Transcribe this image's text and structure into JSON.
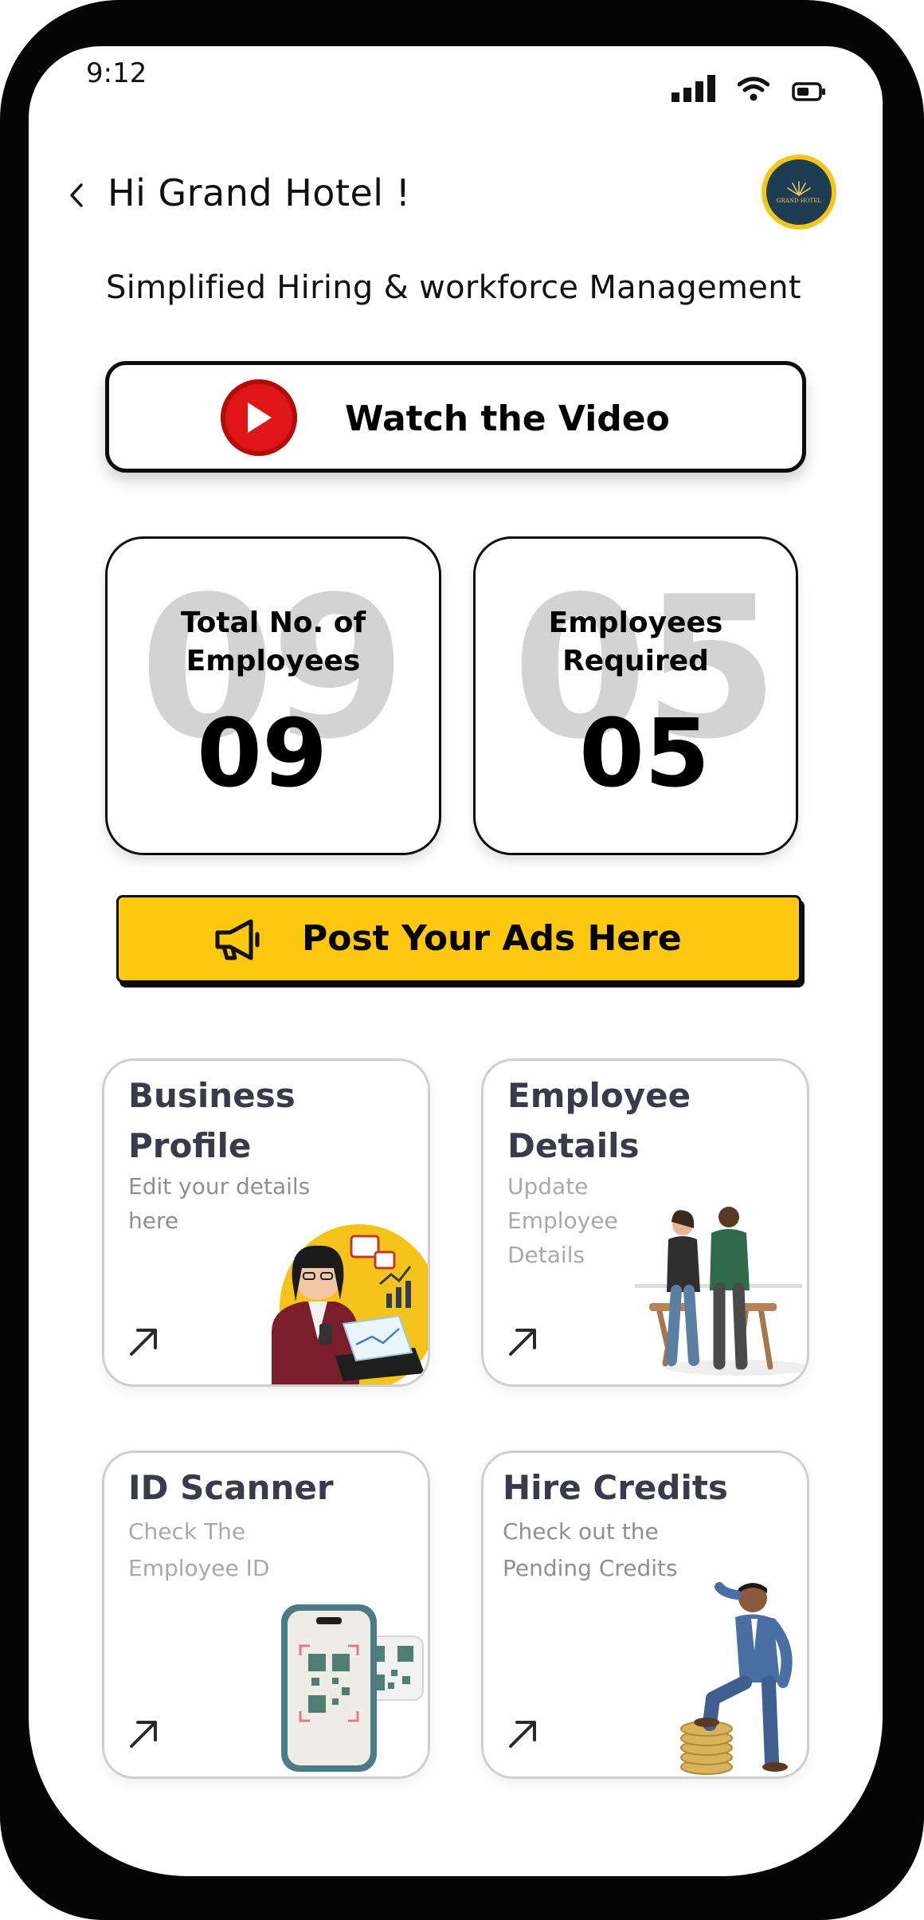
{
  "status_bar": {
    "time": "9:12"
  },
  "header": {
    "greeting": "Hi Grand Hotel !",
    "logo_label": "GRAND HOTEL"
  },
  "tagline": "Simplified Hiring & workforce Management",
  "video_button": {
    "label": "Watch the Video"
  },
  "stats": [
    {
      "title_line1": "Total No. of",
      "title_line2": "Employees",
      "value": "09"
    },
    {
      "title_line1": "Employees",
      "title_line2": "Required",
      "value": "05"
    }
  ],
  "ads_button": {
    "label": "Post Your Ads Here"
  },
  "features": [
    {
      "title": "Business Profile",
      "desc": "Edit your details here"
    },
    {
      "title": "Employee Details",
      "desc": "Update Employee Details"
    },
    {
      "title": "ID Scanner",
      "desc": "Check The Employee ID"
    },
    {
      "title": "Hire Credits",
      "desc": "Check out the Pending Credits"
    }
  ],
  "colors": {
    "accent_yellow": "#fdc80f",
    "play_red": "#e01515",
    "logo_navy": "#1c3d52",
    "title_gray": "#3a3a4a"
  },
  "icons": [
    "back-icon",
    "signal-icon",
    "wifi-icon",
    "battery-icon",
    "play-icon",
    "megaphone-icon",
    "arrow-up-right-icon"
  ]
}
